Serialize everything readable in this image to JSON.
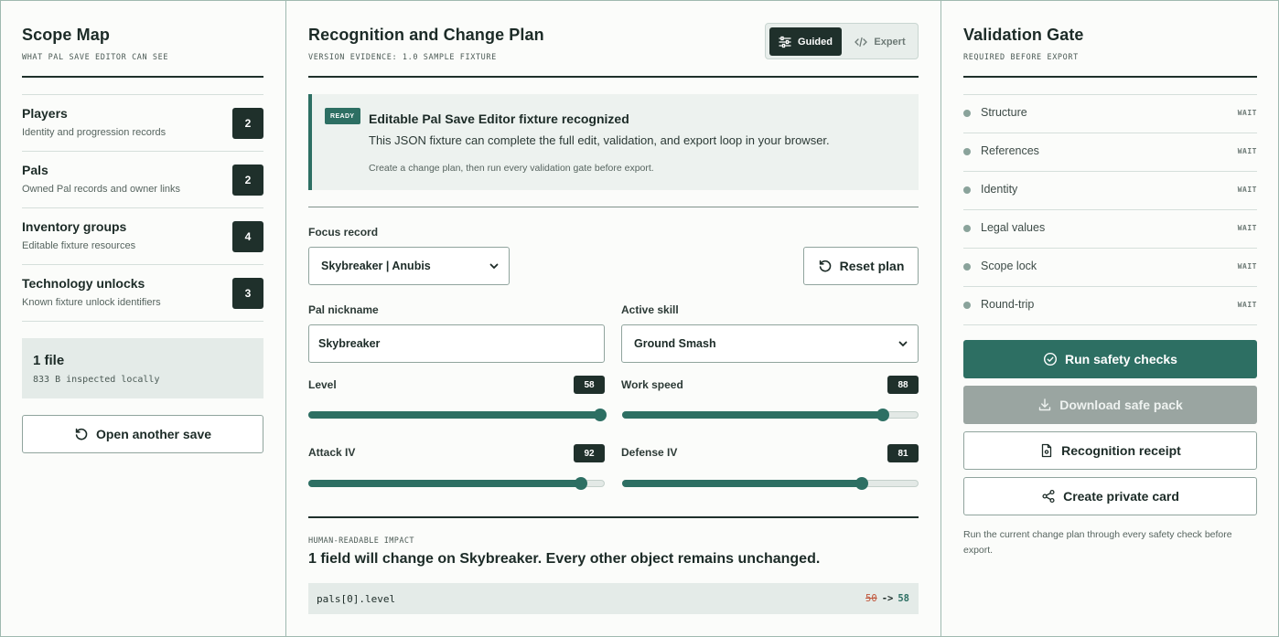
{
  "scope": {
    "title": "Scope Map",
    "subtitle": "WHAT PAL SAVE EDITOR CAN SEE",
    "rows": [
      {
        "title": "Players",
        "sub": "Identity and progression records",
        "count": "2"
      },
      {
        "title": "Pals",
        "sub": "Owned Pal records and owner links",
        "count": "2"
      },
      {
        "title": "Inventory groups",
        "sub": "Editable fixture resources",
        "count": "4"
      },
      {
        "title": "Technology unlocks",
        "sub": "Known fixture unlock identifiers",
        "count": "3"
      }
    ],
    "file": {
      "title": "1 file",
      "sub": "833 B inspected locally"
    },
    "open_button": "Open another save"
  },
  "plan": {
    "title": "Recognition and Change Plan",
    "subtitle": "VERSION EVIDENCE: 1.0 SAMPLE FIXTURE",
    "mode": {
      "guided": "Guided",
      "expert": "Expert",
      "selected": "Guided"
    },
    "notice": {
      "badge": "READY",
      "title": "Editable Pal Save Editor fixture recognized",
      "desc": "This JSON fixture can complete the full edit, validation, and export loop in your browser.",
      "note": "Create a change plan, then run every validation gate before export."
    },
    "focus_label": "Focus record",
    "focus_value": "Skybreaker | Anubis",
    "reset_button": "Reset plan",
    "nickname_label": "Pal nickname",
    "nickname_value": "Skybreaker",
    "skill_label": "Active skill",
    "skill_value": "Ground Smash",
    "sliders": [
      {
        "label": "Level",
        "value": 58,
        "display": "58",
        "fraction": 0.985
      },
      {
        "label": "Work speed",
        "value": 88,
        "display": "88",
        "fraction": 0.88
      },
      {
        "label": "Attack IV",
        "value": 92,
        "display": "92",
        "fraction": 0.92
      },
      {
        "label": "Defense IV",
        "value": 81,
        "display": "81",
        "fraction": 0.81
      }
    ],
    "impact": {
      "heading": "HUMAN-READABLE IMPACT",
      "summary": "1 field will change on Skybreaker. Every other object remains unchanged.",
      "path": "pals[0].level",
      "old": "50",
      "arrow": "->",
      "new": "58"
    }
  },
  "gate": {
    "title": "Validation Gate",
    "subtitle": "REQUIRED BEFORE EXPORT",
    "checks": [
      {
        "label": "Structure",
        "status": "WAIT"
      },
      {
        "label": "References",
        "status": "WAIT"
      },
      {
        "label": "Identity",
        "status": "WAIT"
      },
      {
        "label": "Legal values",
        "status": "WAIT"
      },
      {
        "label": "Scope lock",
        "status": "WAIT"
      },
      {
        "label": "Round-trip",
        "status": "WAIT"
      }
    ],
    "run_button": "Run safety checks",
    "download_button": "Download safe pack",
    "receipt_button": "Recognition receipt",
    "card_button": "Create private card",
    "footnote": "Run the current change plan through every safety check before export."
  },
  "colors": {
    "accent": "#2d6f63",
    "dark": "#1f302b",
    "disabled": "#9aa5a1",
    "old_value": "#c0563b"
  }
}
